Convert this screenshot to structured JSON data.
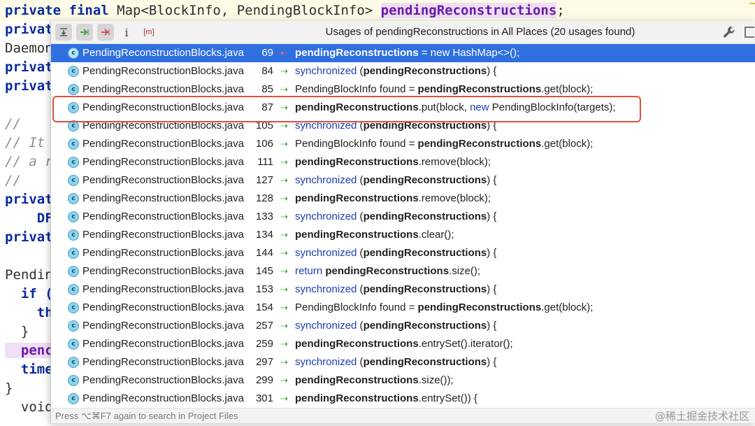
{
  "editor": {
    "lines": [
      {
        "segments": [
          {
            "t": "private final ",
            "c": "kw"
          },
          {
            "t": "Map<BlockInfo, PendingBlockInfo> ",
            "c": "cls"
          },
          {
            "t": "pendingReconstructions",
            "c": "fld"
          },
          {
            "t": ";",
            "c": "cls"
          }
        ]
      },
      {
        "segments": [
          {
            "t": "privat",
            "c": "kw"
          }
        ]
      },
      {
        "segments": [
          {
            "t": "Daemon",
            "c": "cls"
          }
        ]
      },
      {
        "segments": [
          {
            "t": "privat",
            "c": "kw"
          }
        ]
      },
      {
        "segments": [
          {
            "t": "privat",
            "c": "kw"
          }
        ]
      },
      {
        "segments": [
          {
            "t": "",
            "c": "cls"
          }
        ]
      },
      {
        "segments": [
          {
            "t": "//",
            "c": "cmt"
          }
        ]
      },
      {
        "segments": [
          {
            "t": "// It",
            "c": "cmt"
          }
        ]
      },
      {
        "segments": [
          {
            "t": "// a r",
            "c": "cmt"
          }
        ]
      },
      {
        "segments": [
          {
            "t": "//",
            "c": "cmt"
          }
        ]
      },
      {
        "segments": [
          {
            "t": "privat",
            "c": "kw"
          }
        ]
      },
      {
        "segments": [
          {
            "t": "    DF",
            "c": "kw"
          }
        ]
      },
      {
        "segments": [
          {
            "t": "privat",
            "c": "kw"
          }
        ]
      },
      {
        "segments": [
          {
            "t": "",
            "c": "cls"
          }
        ]
      },
      {
        "segments": [
          {
            "t": "Pendin",
            "c": "cls"
          }
        ]
      },
      {
        "segments": [
          {
            "t": "  if (",
            "c": "kw"
          }
        ]
      },
      {
        "segments": [
          {
            "t": "    th",
            "c": "kw"
          }
        ]
      },
      {
        "segments": [
          {
            "t": "  }",
            "c": "cls"
          }
        ]
      },
      {
        "segments": [
          {
            "t": "  penc",
            "c": "fld"
          }
        ]
      },
      {
        "segments": [
          {
            "t": "  time",
            "c": "kw"
          }
        ]
      },
      {
        "segments": [
          {
            "t": "}",
            "c": "cls"
          }
        ]
      },
      {
        "segments": [
          {
            "t": "  void start() {",
            "c": "cls"
          }
        ]
      }
    ]
  },
  "popup": {
    "title": "Usages of pendingReconstructions in All Places (20 usages found)",
    "toolbar": {
      "merge_icon": "merge-usages-icon",
      "read_icon": "read-access-icon",
      "write_icon": "write-access-icon",
      "info_label": "i",
      "module_label": "[m]",
      "settings_icon": "wrench-icon",
      "pin_icon": "pin-icon"
    },
    "rows": [
      {
        "file": "PendingReconstructionBlocks.java",
        "line": "69",
        "access": "write",
        "code": [
          {
            "t": "pendingReconstructions",
            "b": true
          },
          {
            "t": " = new HashMap<>();"
          }
        ]
      },
      {
        "file": "PendingReconstructionBlocks.java",
        "line": "84",
        "access": "read",
        "code": [
          {
            "t": "synchronized",
            "k": true
          },
          {
            "t": " ("
          },
          {
            "t": "pendingReconstructions",
            "b": true
          },
          {
            "t": ") {"
          }
        ]
      },
      {
        "file": "PendingReconstructionBlocks.java",
        "line": "85",
        "access": "read",
        "code": [
          {
            "t": "PendingBlockInfo found = "
          },
          {
            "t": "pendingReconstructions",
            "b": true
          },
          {
            "t": ".get(block);"
          }
        ]
      },
      {
        "file": "PendingReconstructionBlocks.java",
        "line": "87",
        "access": "read",
        "code": [
          {
            "t": "pendingReconstructions",
            "b": true
          },
          {
            "t": ".put(block, "
          },
          {
            "t": "new",
            "k": true
          },
          {
            "t": " PendingBlockInfo(targets);"
          }
        ]
      },
      {
        "file": "PendingReconstructionBlocks.java",
        "line": "105",
        "access": "read",
        "code": [
          {
            "t": "synchronized",
            "k": true
          },
          {
            "t": " ("
          },
          {
            "t": "pendingReconstructions",
            "b": true
          },
          {
            "t": ") {"
          }
        ]
      },
      {
        "file": "PendingReconstructionBlocks.java",
        "line": "106",
        "access": "read",
        "code": [
          {
            "t": "PendingBlockInfo found = "
          },
          {
            "t": "pendingReconstructions",
            "b": true
          },
          {
            "t": ".get(block);"
          }
        ]
      },
      {
        "file": "PendingReconstructionBlocks.java",
        "line": "111",
        "access": "read",
        "code": [
          {
            "t": "pendingReconstructions",
            "b": true
          },
          {
            "t": ".remove(block);"
          }
        ]
      },
      {
        "file": "PendingReconstructionBlocks.java",
        "line": "127",
        "access": "read",
        "code": [
          {
            "t": "synchronized",
            "k": true
          },
          {
            "t": " ("
          },
          {
            "t": "pendingReconstructions",
            "b": true
          },
          {
            "t": ") {"
          }
        ]
      },
      {
        "file": "PendingReconstructionBlocks.java",
        "line": "128",
        "access": "read",
        "code": [
          {
            "t": "pendingReconstructions",
            "b": true
          },
          {
            "t": ".remove(block);"
          }
        ]
      },
      {
        "file": "PendingReconstructionBlocks.java",
        "line": "133",
        "access": "read",
        "code": [
          {
            "t": "synchronized",
            "k": true
          },
          {
            "t": " ("
          },
          {
            "t": "pendingReconstructions",
            "b": true
          },
          {
            "t": ") {"
          }
        ]
      },
      {
        "file": "PendingReconstructionBlocks.java",
        "line": "134",
        "access": "read",
        "code": [
          {
            "t": "pendingReconstructions",
            "b": true
          },
          {
            "t": ".clear();"
          }
        ]
      },
      {
        "file": "PendingReconstructionBlocks.java",
        "line": "144",
        "access": "read",
        "code": [
          {
            "t": "synchronized",
            "k": true
          },
          {
            "t": " ("
          },
          {
            "t": "pendingReconstructions",
            "b": true
          },
          {
            "t": ") {"
          }
        ]
      },
      {
        "file": "PendingReconstructionBlocks.java",
        "line": "145",
        "access": "read",
        "code": [
          {
            "t": "return",
            "k": true
          },
          {
            "t": " "
          },
          {
            "t": "pendingReconstructions",
            "b": true
          },
          {
            "t": ".size();"
          }
        ]
      },
      {
        "file": "PendingReconstructionBlocks.java",
        "line": "153",
        "access": "read",
        "code": [
          {
            "t": "synchronized",
            "k": true
          },
          {
            "t": " ("
          },
          {
            "t": "pendingReconstructions",
            "b": true
          },
          {
            "t": ") {"
          }
        ]
      },
      {
        "file": "PendingReconstructionBlocks.java",
        "line": "154",
        "access": "read",
        "code": [
          {
            "t": "PendingBlockInfo found = "
          },
          {
            "t": "pendingReconstructions",
            "b": true
          },
          {
            "t": ".get(block);"
          }
        ]
      },
      {
        "file": "PendingReconstructionBlocks.java",
        "line": "257",
        "access": "read",
        "code": [
          {
            "t": "synchronized",
            "k": true
          },
          {
            "t": " ("
          },
          {
            "t": "pendingReconstructions",
            "b": true
          },
          {
            "t": ") {"
          }
        ]
      },
      {
        "file": "PendingReconstructionBlocks.java",
        "line": "259",
        "access": "read",
        "code": [
          {
            "t": "pendingReconstructions",
            "b": true
          },
          {
            "t": ".entrySet().iterator();"
          }
        ]
      },
      {
        "file": "PendingReconstructionBlocks.java",
        "line": "297",
        "access": "read",
        "code": [
          {
            "t": "synchronized",
            "k": true
          },
          {
            "t": " ("
          },
          {
            "t": "pendingReconstructions",
            "b": true
          },
          {
            "t": ") {"
          }
        ]
      },
      {
        "file": "PendingReconstructionBlocks.java",
        "line": "299",
        "access": "read",
        "code": [
          {
            "t": "pendingReconstructions",
            "b": true
          },
          {
            "t": ".size());"
          }
        ]
      },
      {
        "file": "PendingReconstructionBlocks.java",
        "line": "301",
        "access": "read",
        "code": [
          {
            "t": "pendingReconstructions",
            "b": true
          },
          {
            "t": ".entrySet()) {"
          }
        ]
      }
    ],
    "selected_index": 0,
    "highlighted_index": 3,
    "status_text": "Press ⌥⌘F7 again to search in Project Files"
  },
  "watermark": "@稀土掘金技术社区",
  "colors": {
    "selection": "#2f6fe0",
    "highlight_border": "#e0503c",
    "keyword": "#1a3eb0",
    "write_arrow": "#cc4444",
    "read_arrow": "#3b9e3b"
  }
}
